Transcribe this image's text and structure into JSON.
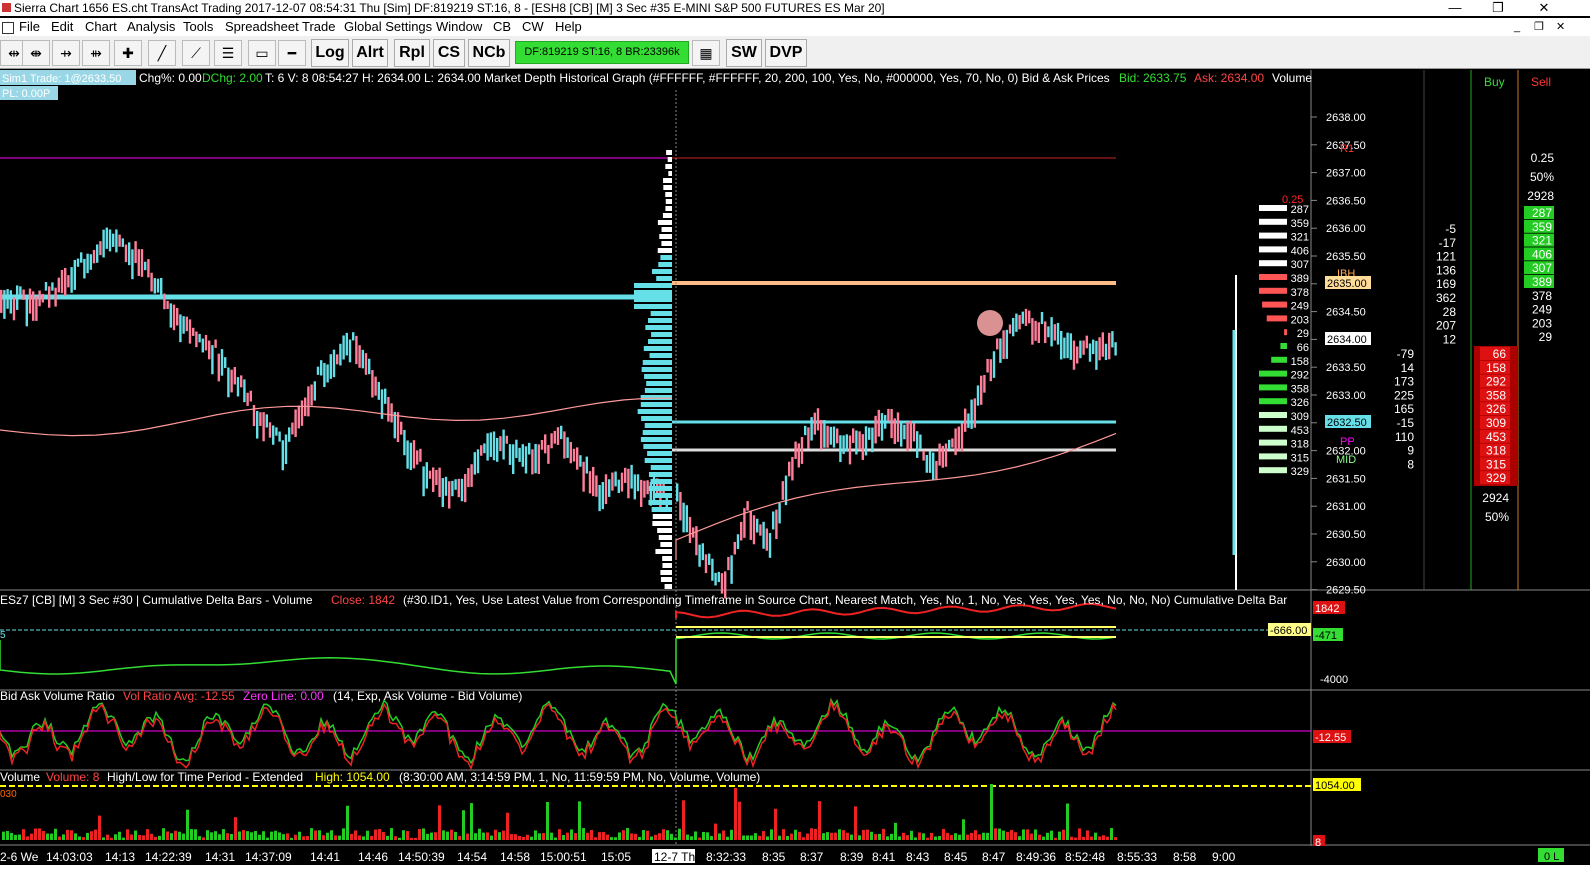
{
  "window": {
    "title": "Sierra Chart 1656 ES.cht  TransAct Trading 2017-12-07  08:54:31 Thu [Sim]  DF:819219  ST:16, 8 - [ESH8 [CB] [M]  3 Sec  #35  E-MINI S&P 500 FUTURES ES Mar 20]",
    "minimize": "—",
    "restore": "❐",
    "close": "✕"
  },
  "menu": [
    "File",
    "Edit",
    "Chart",
    "Analysis",
    "Tools",
    "Spreadsheet",
    "Trade",
    "Global Settings",
    "Window",
    "CB",
    "CW",
    "Help"
  ],
  "toolbar": {
    "buttons": [
      "Log",
      "Alrt",
      "Rpl",
      "CS",
      "NCb",
      "SW",
      "DVP"
    ],
    "status": "DF:819219  ST:16, 8  BR:23396k",
    "icons": [
      "zoom-out-icon",
      "zoom-in-icon",
      "scroll-left-icon",
      "scroll-right-icon",
      "crosshair-icon",
      "draw-line-icon",
      "ray-icon",
      "fib-icon",
      "rectangle-icon",
      "hline-icon",
      "dom-icon"
    ]
  },
  "main": {
    "header_left": "Sim1 Trade: 1@2633.50",
    "header_left2": "PL: 0.00P",
    "header": {
      "chg": "Chg%: 0.00",
      "dchg": "DChg: 2.00",
      "info": "T: 6 V: 8 08:54:27 H: 2634.00 L: 2634.00  Market Depth Historical Graph   (#FFFFFF, #FFFFFF, 20, 200, 100, Yes, No, #000000, Yes, 70, No, 0)  Bid & Ask Prices",
      "bid": "Bid: 2633.75",
      "ask": "Ask: 2634.00",
      "volume": "Volume"
    },
    "price_axis": [
      "2638.00",
      "2637.50",
      "2637.00",
      "2636.50",
      "2636.00",
      "2635.50",
      "2635.00",
      "2634.50",
      "2634.00",
      "2633.50",
      "2633.00",
      "2632.50",
      "2632.00",
      "2631.50",
      "2631.00",
      "2630.50",
      "2630.00",
      "2629.50"
    ],
    "highlighted_prices": {
      "p1": "2635.00",
      "p2": "2634.00",
      "p3": "2632.50"
    },
    "level_labels": {
      "r1": "R1",
      "ibh": "IBH",
      "pp": "PP",
      "mid": "MID",
      "top_red": "0.25"
    },
    "dom_sizes": [
      "287",
      "359",
      "321",
      "406",
      "307",
      "389",
      "378",
      "249",
      "203",
      "29",
      "66",
      "158",
      "292",
      "358",
      "326",
      "309",
      "453",
      "318",
      "315",
      "329"
    ],
    "col_a": [
      "-5",
      "-17",
      "121",
      "136",
      "169",
      "362",
      "28",
      "207",
      "12"
    ],
    "col_b": [
      "-79",
      "14",
      "173",
      "225",
      "165",
      "-15",
      "110",
      "9",
      "8"
    ],
    "buy_label": "Buy",
    "sell_label": "Sell",
    "sell_top": [
      "0.25",
      "50%",
      "2928"
    ],
    "ask_sizes": [
      "287",
      "359",
      "321",
      "406",
      "307",
      "389",
      "378",
      "249",
      "203",
      "29"
    ],
    "bid_sizes": [
      "66",
      "158",
      "292",
      "358",
      "326",
      "309",
      "453",
      "318",
      "315",
      "329"
    ],
    "buy_bottom": [
      "2924",
      "50%"
    ]
  },
  "delta_panel": {
    "title": "ESz7 [CB] [M]  3 Sec   #30 | Cumulative Delta Bars - Volume",
    "close": "Close: 1842",
    "params": "(#30.ID1, Yes, Use Latest Value from Corresponding Timeframe in Source Chart, Nearest Match, Yes, No, 1, No, Yes, Yes, Yes, Yes, No, No, No)  Cumulative Delta Bar",
    "val1": "1842",
    "val2": "-666.00",
    "val3": "-471",
    "axis": "-4000",
    "left_mark": "5"
  },
  "ratio_panel": {
    "title": "Bid Ask Volume Ratio",
    "avg": "Vol Ratio Avg: -12.55",
    "zero": "Zero Line: 0.00",
    "params": "(14, Exp, Ask Volume - Bid Volume)",
    "value": "-12.55"
  },
  "volume_panel": {
    "title": "Volume",
    "vol": "Volume: 8",
    "study": "High/Low for Time Period - Extended",
    "high": "High: 1054.00",
    "params": "(8:30:00 AM, 3:14:59 PM, 1, No, 11:59:59 PM, No, Volume, Volume)",
    "high_val": "1054.00",
    "left_mark": "030",
    "cur": "8"
  },
  "time_axis": [
    "2-6 We",
    "14:03:03",
    "14:13",
    "14:22:39",
    "14:31",
    "14:37:09",
    "14:41",
    "14:46",
    "14:50:39",
    "14:54",
    "14:58",
    "15:00:51",
    "15:05",
    "12-7 Th",
    "8:32:33",
    "8:35",
    "8:37",
    "8:39",
    "8:41",
    "8:43",
    "8:45",
    "8:47",
    "8:49:36",
    "8:52:48",
    "8:55:33",
    "8:58",
    "9:00"
  ],
  "corner_label": "0 L",
  "colors": {
    "cyan": "#66e0e8",
    "pink": "#ff7f9a",
    "green": "#33dd33",
    "red": "#dd1111",
    "yellow": "#ffff00",
    "magenta": "#ff00ff",
    "peach": "#ffbb88"
  }
}
